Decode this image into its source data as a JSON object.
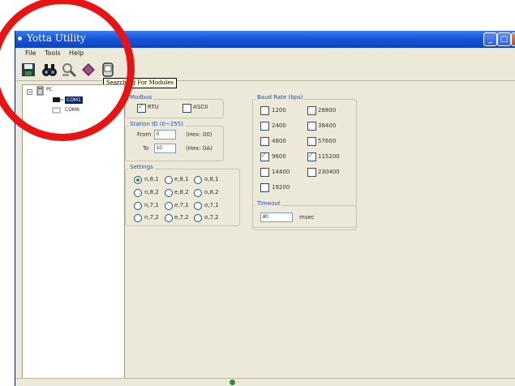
{
  "window": {
    "title": "Yotta Utility"
  },
  "menu": {
    "file": "File",
    "tools": "Tools",
    "help": "Help"
  },
  "toolbar": {
    "tooltip": "Searching For Modules"
  },
  "tree": {
    "root": "PC",
    "items": [
      "COM1",
      "COM6"
    ],
    "selected": "COM1"
  },
  "modbus": {
    "title": "Modbus",
    "rtu": "RTU",
    "ascii": "ASCII",
    "rtu_checked": true,
    "ascii_checked": false
  },
  "station": {
    "title": "Station ID (0~255)",
    "from_label": "From",
    "from_value": "0",
    "from_hex": "(Hex: 00)",
    "to_label": "To",
    "to_value": "10",
    "to_hex": "(Hex: 0A)"
  },
  "settings": {
    "title": "Settings",
    "options": [
      [
        "n,8,1",
        "e,8,1",
        "o,8,1"
      ],
      [
        "n,8,2",
        "e,8,2",
        "o,8,2"
      ],
      [
        "n,7,1",
        "e,7,1",
        "o,7,1"
      ],
      [
        "n,7,2",
        "e,7,2",
        "o,7,2"
      ]
    ],
    "selected": "n,8,1"
  },
  "baud": {
    "title": "Baud Rate (bps)",
    "rates": [
      "1200",
      "28800",
      "2400",
      "38400",
      "4800",
      "57600",
      "9600",
      "115200",
      "14400",
      "230400",
      "19200"
    ],
    "checked": [
      "9600",
      "115200"
    ]
  },
  "timeout": {
    "title": "Timeout",
    "value": "80",
    "unit": "msec"
  },
  "colors": {
    "highlight": "#e81414",
    "title_bar": "#1656d8",
    "panel": "#ece9d8",
    "check": "#21a121"
  }
}
